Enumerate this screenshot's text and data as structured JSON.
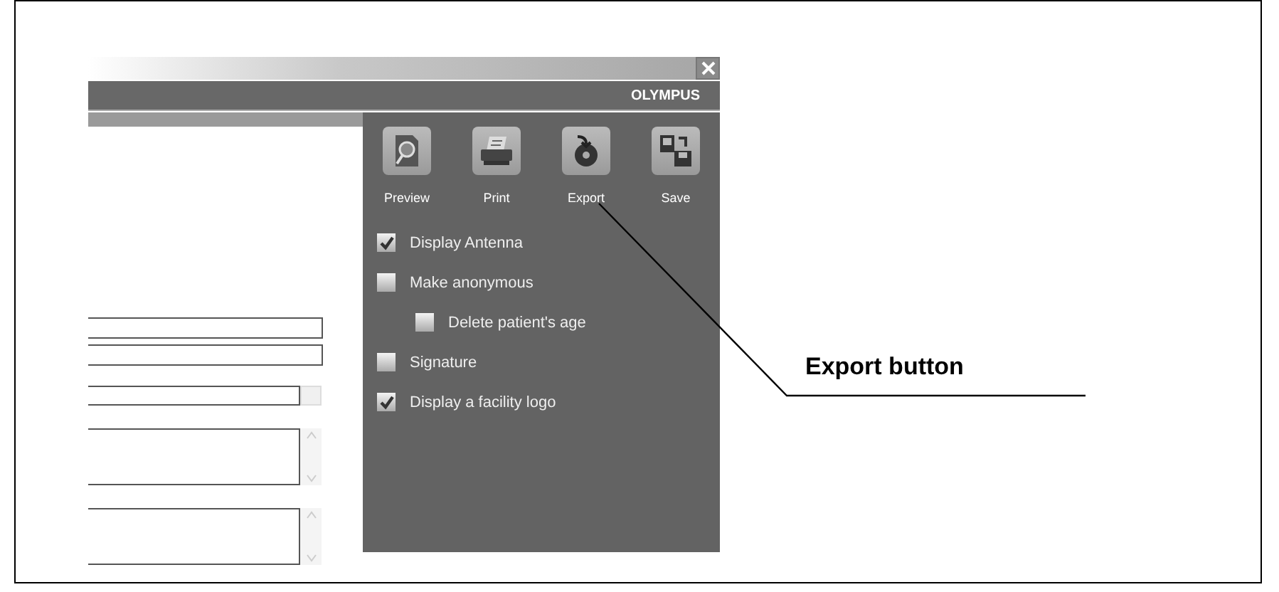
{
  "window": {
    "brand": "OLYMPUS"
  },
  "toolbar": [
    {
      "label": "Preview",
      "kind": "preview"
    },
    {
      "label": "Print",
      "kind": "print"
    },
    {
      "label": "Export",
      "kind": "export"
    },
    {
      "label": "Save",
      "kind": "save"
    }
  ],
  "options": [
    {
      "label": "Display Antenna",
      "checked": true
    },
    {
      "label": "Make anonymous",
      "checked": false,
      "children": [
        {
          "label": "Delete patient's age",
          "checked": false
        }
      ]
    },
    {
      "label": "Signature",
      "checked": false
    },
    {
      "label": "Display a facility logo",
      "checked": true
    }
  ],
  "form_fields": [
    {
      "kind": "line"
    },
    {
      "kind": "line"
    },
    {
      "kind": "spinner"
    },
    {
      "kind": "textarea"
    },
    {
      "kind": "textarea"
    }
  ],
  "callout": {
    "label": "Export button"
  }
}
